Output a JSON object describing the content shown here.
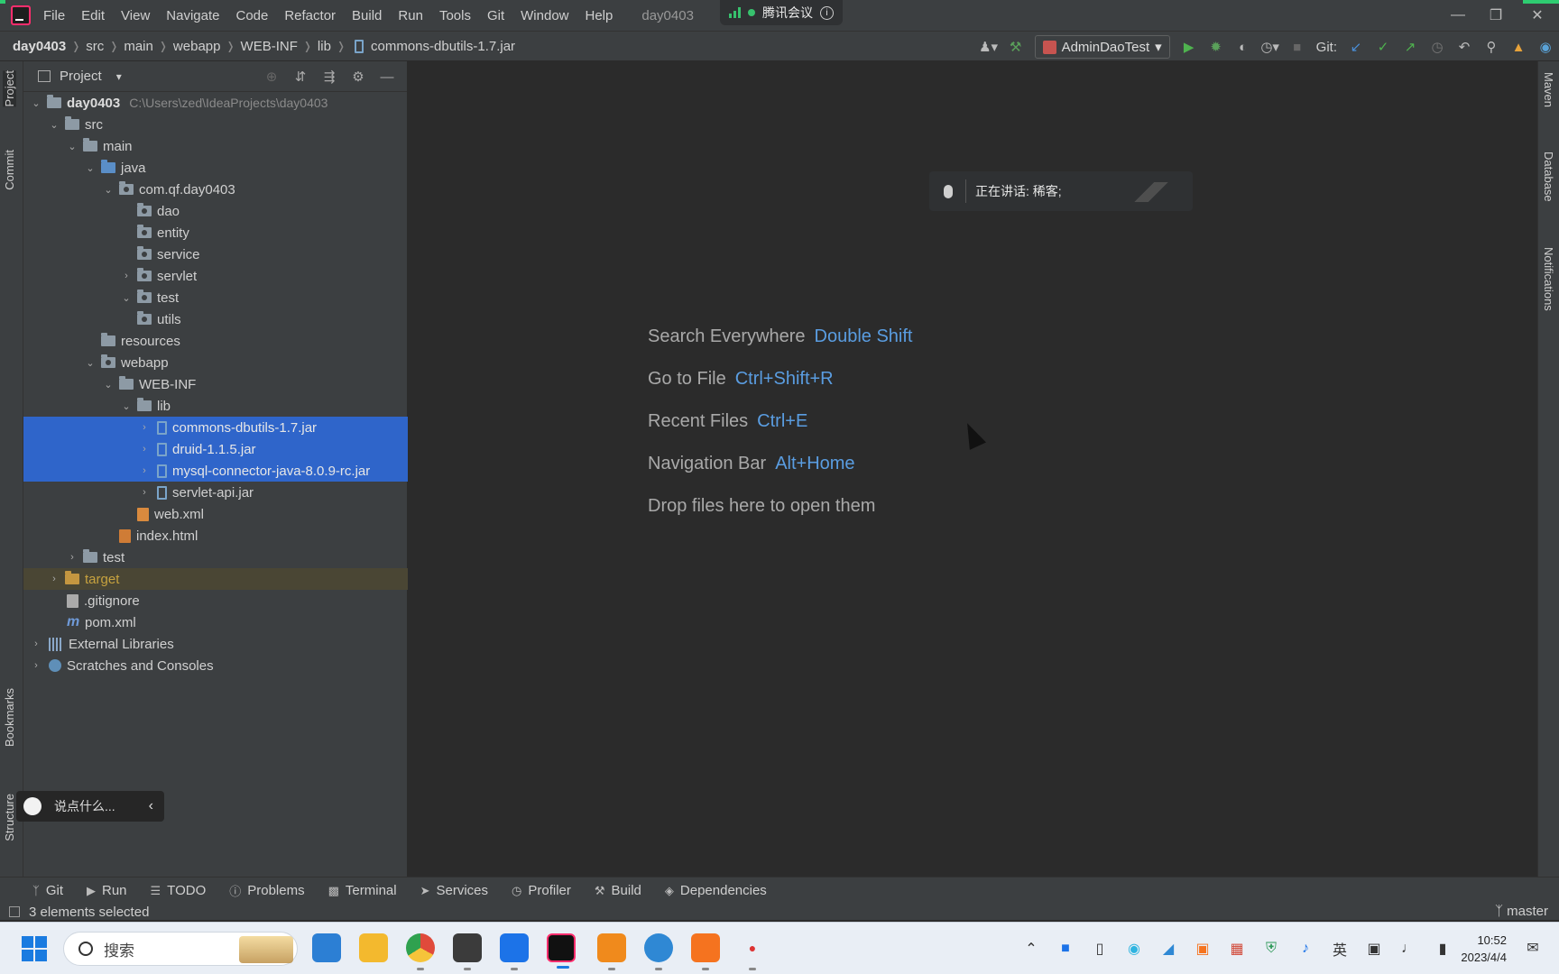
{
  "menubar": {
    "items": [
      "File",
      "Edit",
      "View",
      "Navigate",
      "Code",
      "Refactor",
      "Build",
      "Run",
      "Tools",
      "Git",
      "Window",
      "Help"
    ],
    "project_title": "day0403",
    "meeting_app": "腾讯会议"
  },
  "breadcrumb": {
    "items": [
      "day0403",
      "src",
      "main",
      "webapp",
      "WEB-INF",
      "lib",
      "commons-dbutils-1.7.jar"
    ]
  },
  "toolbar": {
    "run_config": "AdminDaoTest",
    "git_label": "Git:"
  },
  "project_panel": {
    "title": "Project",
    "tree": [
      {
        "label": "day0403",
        "path": "C:\\Users\\zed\\IdeaProjects\\day0403"
      },
      {
        "label": "src"
      },
      {
        "label": "main"
      },
      {
        "label": "java"
      },
      {
        "label": "com.qf.day0403"
      },
      {
        "label": "dao"
      },
      {
        "label": "entity"
      },
      {
        "label": "service"
      },
      {
        "label": "servlet"
      },
      {
        "label": "test"
      },
      {
        "label": "utils"
      },
      {
        "label": "resources"
      },
      {
        "label": "webapp"
      },
      {
        "label": "WEB-INF"
      },
      {
        "label": "lib"
      },
      {
        "label": "commons-dbutils-1.7.jar"
      },
      {
        "label": "druid-1.1.5.jar"
      },
      {
        "label": "mysql-connector-java-8.0.9-rc.jar"
      },
      {
        "label": "servlet-api.jar"
      },
      {
        "label": "web.xml"
      },
      {
        "label": "index.html"
      },
      {
        "label": "test"
      },
      {
        "label": "target"
      },
      {
        "label": ".gitignore"
      },
      {
        "label": "pom.xml"
      },
      {
        "label": "External Libraries"
      },
      {
        "label": "Scratches and Consoles"
      }
    ]
  },
  "left_strip": {
    "project": "Project",
    "commit": "Commit",
    "bookmarks": "Bookmarks",
    "structure": "Structure"
  },
  "right_strip": {
    "maven": "Maven",
    "database": "Database",
    "notifications": "Notifications"
  },
  "editor": {
    "hints": [
      {
        "label": "Search Everywhere",
        "key": "Double Shift"
      },
      {
        "label": "Go to File",
        "key": "Ctrl+Shift+R"
      },
      {
        "label": "Recent Files",
        "key": "Ctrl+E"
      },
      {
        "label": "Navigation Bar",
        "key": "Alt+Home"
      },
      {
        "label": "Drop files here to open them",
        "key": ""
      }
    ],
    "speaking": "正在讲话: 稀客;"
  },
  "chat": {
    "placeholder": "说点什么..."
  },
  "tool_tabs": [
    "Git",
    "Run",
    "TODO",
    "Problems",
    "Terminal",
    "Services",
    "Profiler",
    "Build",
    "Dependencies"
  ],
  "status": {
    "text": "3 elements selected",
    "branch": "master"
  },
  "taskbar": {
    "search": "搜索",
    "ime": "英",
    "time": "10:52",
    "date": "2023/4/4"
  },
  "colors": {
    "selection": "#2f65ca",
    "accent": "#5a9de1",
    "panel": "#3c3f41",
    "editor": "#2b2b2b"
  }
}
